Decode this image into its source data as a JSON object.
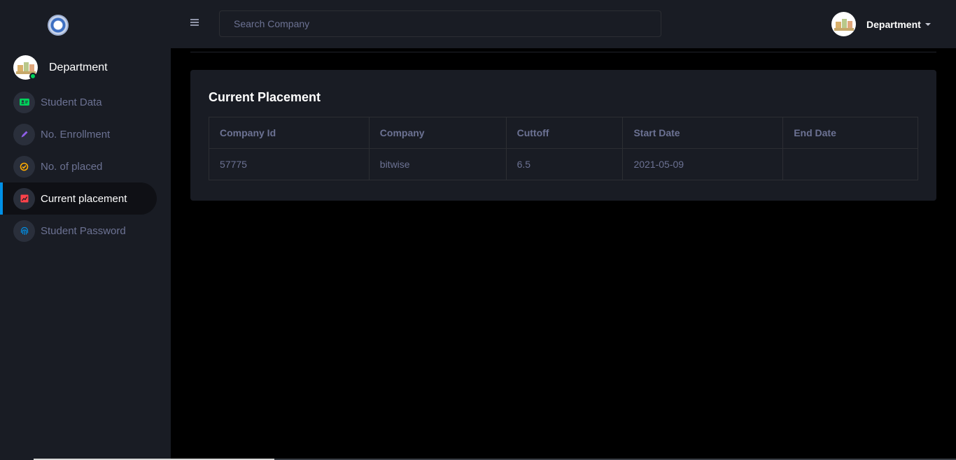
{
  "sidebar": {
    "profile_name": "Department",
    "items": [
      {
        "label": "Student Data",
        "icon": "id-card-icon",
        "color": "#00d25b"
      },
      {
        "label": "No. Enrollment",
        "icon": "pencil-icon",
        "color": "#8f5fe8"
      },
      {
        "label": "No. of placed",
        "icon": "check-circle-icon",
        "color": "#ffab00"
      },
      {
        "label": "Current placement",
        "icon": "chart-icon",
        "color": "#fc424a",
        "active": true
      },
      {
        "label": "Student Password",
        "icon": "fingerprint-icon",
        "color": "#0090e7"
      }
    ]
  },
  "topbar": {
    "search_placeholder": "Search Company",
    "user_name": "Department"
  },
  "main": {
    "title": "Current Placement",
    "table": {
      "headers": [
        "Company Id",
        "Company",
        "Cuttoff",
        "Start Date",
        "End Date"
      ],
      "rows": [
        [
          "57775",
          "bitwise",
          "6.5",
          "2021-05-09",
          ""
        ]
      ]
    }
  },
  "colors": {
    "sidebar_bg": "#191c24",
    "content_bg": "#000000",
    "accent": "#0090e7",
    "muted_text": "#6c7293"
  }
}
